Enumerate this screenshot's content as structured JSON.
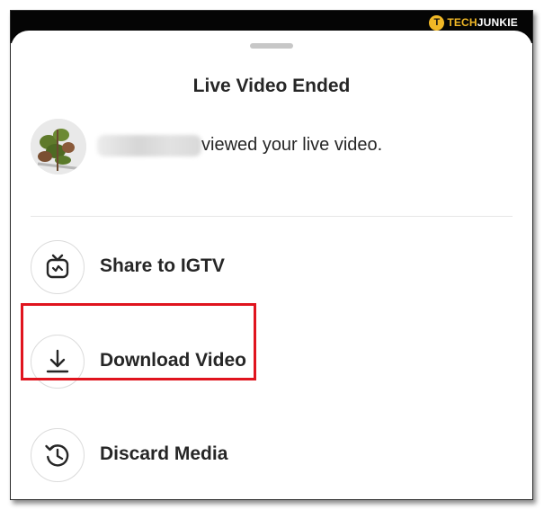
{
  "watermark": {
    "logo_letter": "T",
    "brand_part1": "TECH",
    "brand_part2": "JUNKIE"
  },
  "sheet": {
    "title": "Live Video Ended"
  },
  "viewer": {
    "message": "viewed your live video."
  },
  "actions": [
    {
      "label": "Share to IGTV",
      "icon": "igtv-icon"
    },
    {
      "label": "Download Video",
      "icon": "download-icon"
    },
    {
      "label": "Discard Media",
      "icon": "history-discard-icon"
    }
  ],
  "colors": {
    "highlight": "#e0141e",
    "text": "#262626",
    "brand_accent": "#f1b826"
  }
}
